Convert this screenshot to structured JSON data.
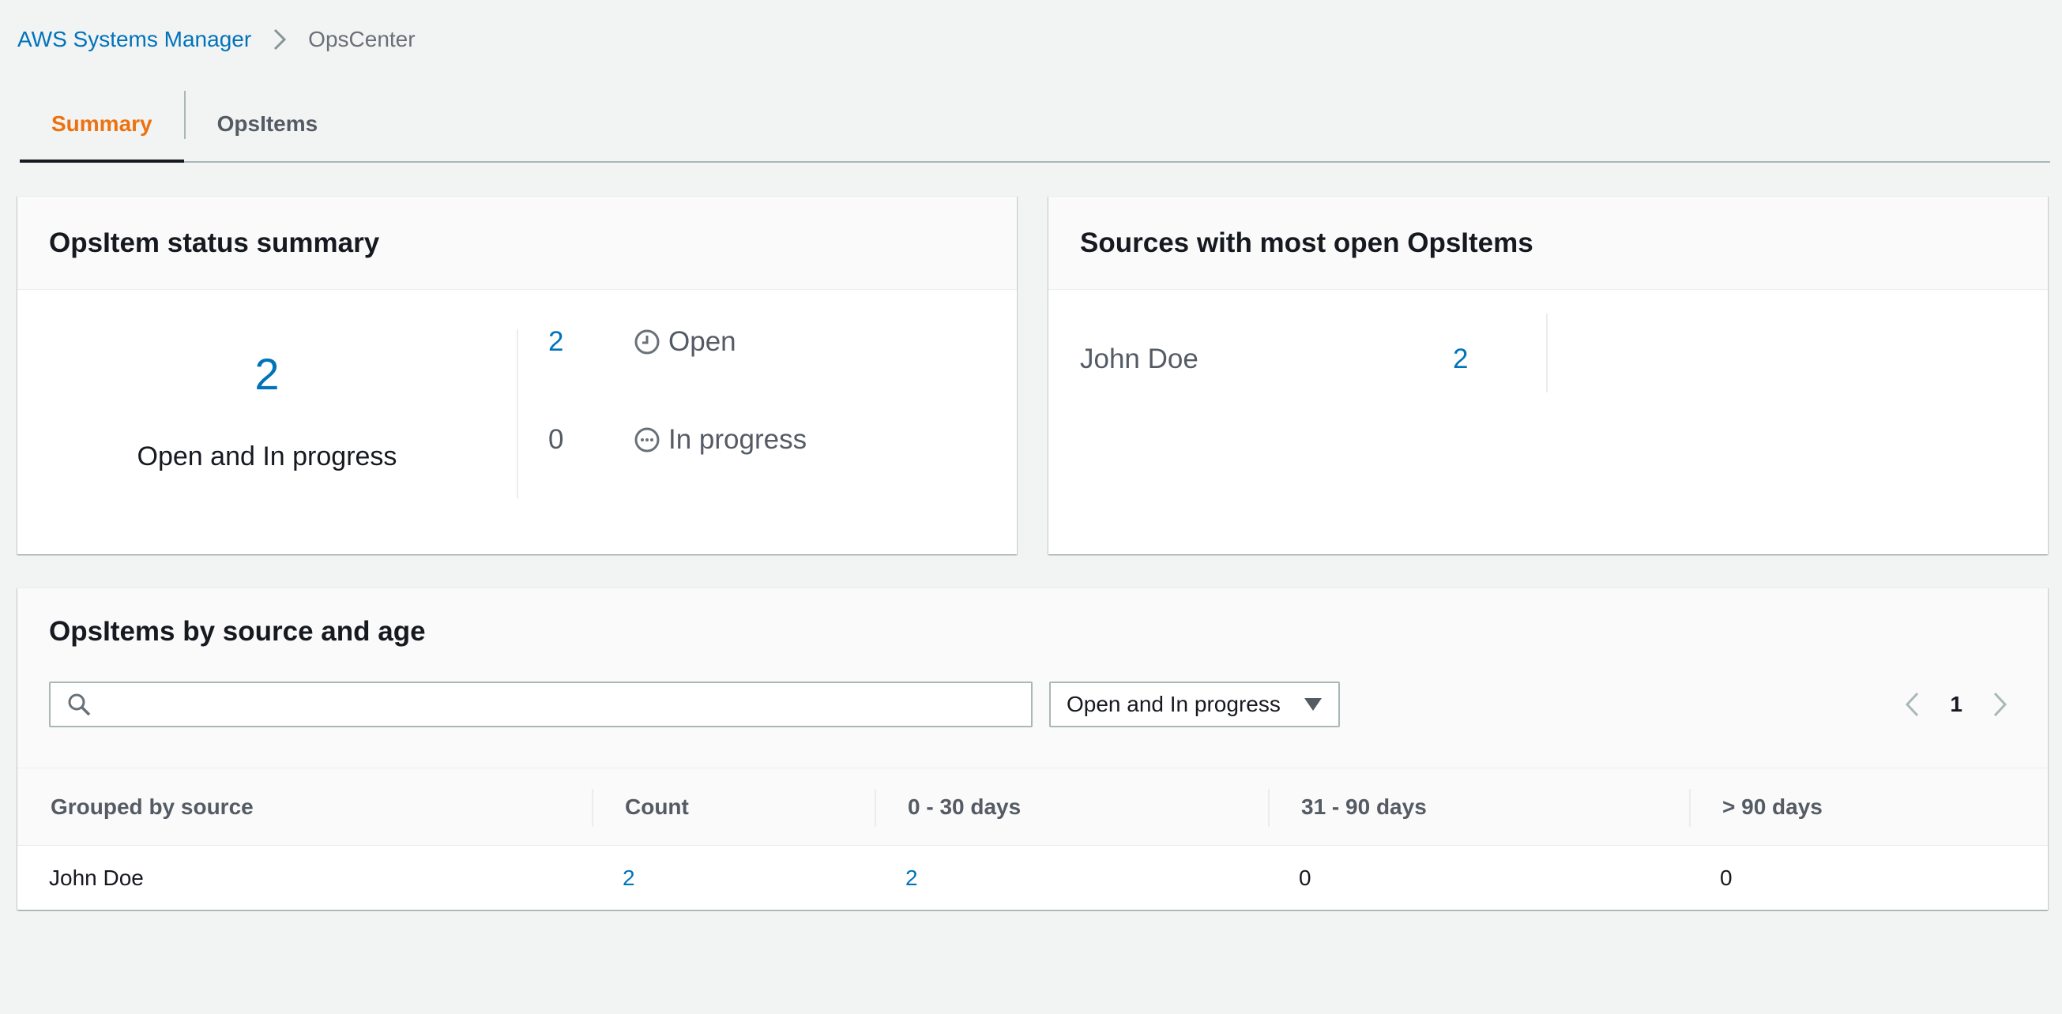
{
  "breadcrumb": {
    "parent": "AWS Systems Manager",
    "current": "OpsCenter"
  },
  "tabs": [
    {
      "label": "Summary",
      "active": true
    },
    {
      "label": "OpsItems",
      "active": false
    }
  ],
  "status_summary": {
    "title": "OpsItem status summary",
    "total": "2",
    "total_label": "Open and In progress",
    "rows": [
      {
        "count": "2",
        "label": "Open",
        "icon": "clock-icon"
      },
      {
        "count": "0",
        "label": "In progress",
        "icon": "ellipsis-circle-icon"
      }
    ]
  },
  "sources": {
    "title": "Sources with most open OpsItems",
    "items": [
      {
        "name": "John Doe",
        "count": "2"
      }
    ]
  },
  "age_table": {
    "title": "OpsItems by source and age",
    "search_placeholder": "",
    "filter_value": "Open and In progress",
    "page": "1",
    "columns": [
      "Grouped by source",
      "Count",
      "0 - 30 days",
      "31 - 90 days",
      "> 90 days"
    ],
    "rows": [
      [
        "John Doe",
        "2",
        "2",
        "0",
        "0"
      ]
    ]
  },
  "colors": {
    "link": "#0073bb",
    "active_tab": "#ec7211",
    "background": "#f2f3f3"
  }
}
